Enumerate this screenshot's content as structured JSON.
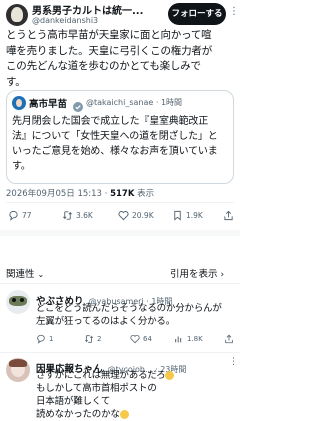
{
  "post": {
    "author_name": "男系男子カルトは統一...",
    "author_handle": "@dankeidanshi3",
    "follow_label": "フォローする",
    "text_lines": [
      "とうとう高市早苗が天皇家に面と向かって喧",
      "嘩を売りました。天皇に弓引くこの権力者が",
      "この先どんな道を歩むのかとても楽しみで",
      "す。"
    ],
    "quote": {
      "author_name": "高市早苗",
      "author_handle": "@takaichi_sanae · 1時間",
      "text_lines": [
        "先月閉会した国会で成立した『皇室典範改正",
        "法』について「女性天皇への道を閉ざした」と",
        "いったご意見を始め、様々なお声を頂いていま",
        "す。"
      ]
    },
    "timestamp": "2026年09月05日 15:13",
    "views_count": "517K",
    "views_label": "表示",
    "actions": {
      "replies": "77",
      "reposts": "3.6K",
      "likes": "20.9K",
      "bookmarks": "1.9K"
    }
  },
  "replies_bar": {
    "sort_label": "関連性",
    "quotes_label": "引用を表示"
  },
  "replies": [
    {
      "author_name": "やぶさめり",
      "author_handle": "@yabusameri · 1時間",
      "text_lines": [
        "どこをどう読んだらそうなるのか分からんが",
        "左翼が狂ってるのはよく分かる。"
      ],
      "actions": {
        "replies": "1",
        "reposts": "2",
        "likes": "64",
        "views": "1.8K"
      }
    },
    {
      "author_name": "因果応報ちゃん",
      "author_handle": "@tycojoh... · 23時間",
      "text_lines": [
        "さすがにこれは無理があるだろ",
        "もしかして高市首相ポストの",
        "日本語が難しくて",
        "読めなかったのかな"
      ]
    }
  ],
  "colors": {
    "accent": "#1d9bf0",
    "text": "#0f1419",
    "muted": "#536471",
    "border": "#cfd9de"
  }
}
